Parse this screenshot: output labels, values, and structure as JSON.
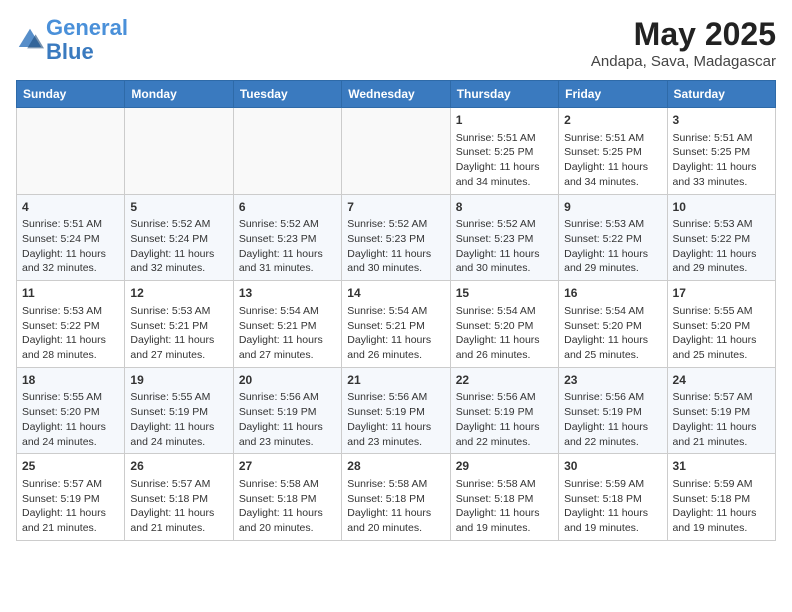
{
  "header": {
    "logo_line1": "General",
    "logo_line2": "Blue",
    "month": "May 2025",
    "location": "Andapa, Sava, Madagascar"
  },
  "weekdays": [
    "Sunday",
    "Monday",
    "Tuesday",
    "Wednesday",
    "Thursday",
    "Friday",
    "Saturday"
  ],
  "weeks": [
    [
      {
        "day": "",
        "info": ""
      },
      {
        "day": "",
        "info": ""
      },
      {
        "day": "",
        "info": ""
      },
      {
        "day": "",
        "info": ""
      },
      {
        "day": "1",
        "info": "Sunrise: 5:51 AM\nSunset: 5:25 PM\nDaylight: 11 hours\nand 34 minutes."
      },
      {
        "day": "2",
        "info": "Sunrise: 5:51 AM\nSunset: 5:25 PM\nDaylight: 11 hours\nand 34 minutes."
      },
      {
        "day": "3",
        "info": "Sunrise: 5:51 AM\nSunset: 5:25 PM\nDaylight: 11 hours\nand 33 minutes."
      }
    ],
    [
      {
        "day": "4",
        "info": "Sunrise: 5:51 AM\nSunset: 5:24 PM\nDaylight: 11 hours\nand 32 minutes."
      },
      {
        "day": "5",
        "info": "Sunrise: 5:52 AM\nSunset: 5:24 PM\nDaylight: 11 hours\nand 32 minutes."
      },
      {
        "day": "6",
        "info": "Sunrise: 5:52 AM\nSunset: 5:23 PM\nDaylight: 11 hours\nand 31 minutes."
      },
      {
        "day": "7",
        "info": "Sunrise: 5:52 AM\nSunset: 5:23 PM\nDaylight: 11 hours\nand 30 minutes."
      },
      {
        "day": "8",
        "info": "Sunrise: 5:52 AM\nSunset: 5:23 PM\nDaylight: 11 hours\nand 30 minutes."
      },
      {
        "day": "9",
        "info": "Sunrise: 5:53 AM\nSunset: 5:22 PM\nDaylight: 11 hours\nand 29 minutes."
      },
      {
        "day": "10",
        "info": "Sunrise: 5:53 AM\nSunset: 5:22 PM\nDaylight: 11 hours\nand 29 minutes."
      }
    ],
    [
      {
        "day": "11",
        "info": "Sunrise: 5:53 AM\nSunset: 5:22 PM\nDaylight: 11 hours\nand 28 minutes."
      },
      {
        "day": "12",
        "info": "Sunrise: 5:53 AM\nSunset: 5:21 PM\nDaylight: 11 hours\nand 27 minutes."
      },
      {
        "day": "13",
        "info": "Sunrise: 5:54 AM\nSunset: 5:21 PM\nDaylight: 11 hours\nand 27 minutes."
      },
      {
        "day": "14",
        "info": "Sunrise: 5:54 AM\nSunset: 5:21 PM\nDaylight: 11 hours\nand 26 minutes."
      },
      {
        "day": "15",
        "info": "Sunrise: 5:54 AM\nSunset: 5:20 PM\nDaylight: 11 hours\nand 26 minutes."
      },
      {
        "day": "16",
        "info": "Sunrise: 5:54 AM\nSunset: 5:20 PM\nDaylight: 11 hours\nand 25 minutes."
      },
      {
        "day": "17",
        "info": "Sunrise: 5:55 AM\nSunset: 5:20 PM\nDaylight: 11 hours\nand 25 minutes."
      }
    ],
    [
      {
        "day": "18",
        "info": "Sunrise: 5:55 AM\nSunset: 5:20 PM\nDaylight: 11 hours\nand 24 minutes."
      },
      {
        "day": "19",
        "info": "Sunrise: 5:55 AM\nSunset: 5:19 PM\nDaylight: 11 hours\nand 24 minutes."
      },
      {
        "day": "20",
        "info": "Sunrise: 5:56 AM\nSunset: 5:19 PM\nDaylight: 11 hours\nand 23 minutes."
      },
      {
        "day": "21",
        "info": "Sunrise: 5:56 AM\nSunset: 5:19 PM\nDaylight: 11 hours\nand 23 minutes."
      },
      {
        "day": "22",
        "info": "Sunrise: 5:56 AM\nSunset: 5:19 PM\nDaylight: 11 hours\nand 22 minutes."
      },
      {
        "day": "23",
        "info": "Sunrise: 5:56 AM\nSunset: 5:19 PM\nDaylight: 11 hours\nand 22 minutes."
      },
      {
        "day": "24",
        "info": "Sunrise: 5:57 AM\nSunset: 5:19 PM\nDaylight: 11 hours\nand 21 minutes."
      }
    ],
    [
      {
        "day": "25",
        "info": "Sunrise: 5:57 AM\nSunset: 5:19 PM\nDaylight: 11 hours\nand 21 minutes."
      },
      {
        "day": "26",
        "info": "Sunrise: 5:57 AM\nSunset: 5:18 PM\nDaylight: 11 hours\nand 21 minutes."
      },
      {
        "day": "27",
        "info": "Sunrise: 5:58 AM\nSunset: 5:18 PM\nDaylight: 11 hours\nand 20 minutes."
      },
      {
        "day": "28",
        "info": "Sunrise: 5:58 AM\nSunset: 5:18 PM\nDaylight: 11 hours\nand 20 minutes."
      },
      {
        "day": "29",
        "info": "Sunrise: 5:58 AM\nSunset: 5:18 PM\nDaylight: 11 hours\nand 19 minutes."
      },
      {
        "day": "30",
        "info": "Sunrise: 5:59 AM\nSunset: 5:18 PM\nDaylight: 11 hours\nand 19 minutes."
      },
      {
        "day": "31",
        "info": "Sunrise: 5:59 AM\nSunset: 5:18 PM\nDaylight: 11 hours\nand 19 minutes."
      }
    ]
  ]
}
